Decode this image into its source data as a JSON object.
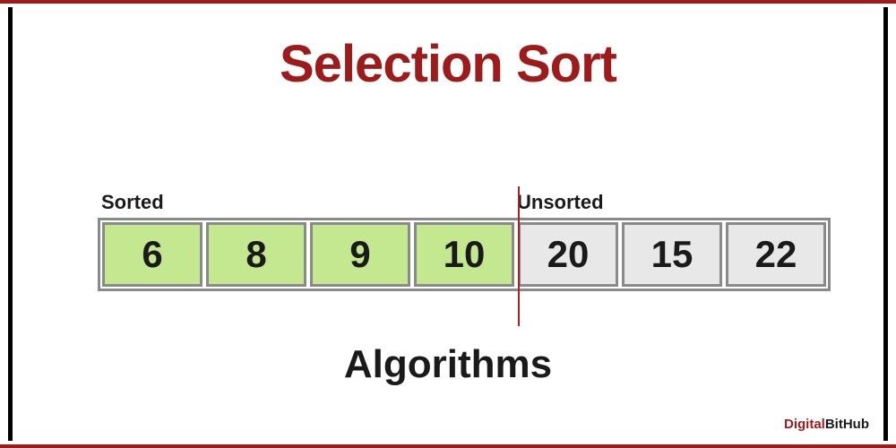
{
  "title": "Selection Sort",
  "subtitle": "Algorithms",
  "labels": {
    "sorted": "Sorted",
    "unsorted": "Unsorted"
  },
  "array": {
    "sorted": [
      "6",
      "8",
      "9",
      "10"
    ],
    "unsorted": [
      "20",
      "15",
      "22"
    ]
  },
  "watermark": {
    "part1": "Digital",
    "part2": "BitHub"
  },
  "colors": {
    "accent": "#9e1b1b",
    "sorted_bg": "#c4e88f",
    "unsorted_bg": "#e8e8e8"
  }
}
